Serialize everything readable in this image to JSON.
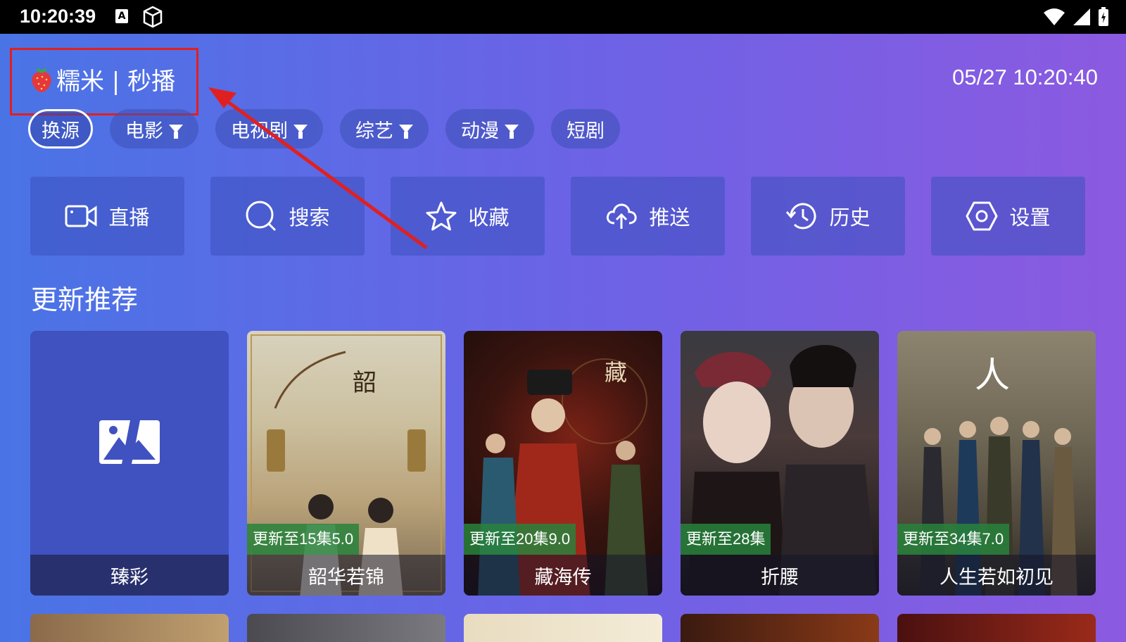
{
  "status": {
    "time": "10:20:39",
    "a_label": "A"
  },
  "header": {
    "brand": "糯米 | 秒播",
    "clock": "05/27 10:20:40"
  },
  "chips": [
    {
      "label": "换源",
      "filter": false,
      "active": true
    },
    {
      "label": "电影",
      "filter": true
    },
    {
      "label": "电视剧",
      "filter": true
    },
    {
      "label": "综艺",
      "filter": true
    },
    {
      "label": "动漫",
      "filter": true
    },
    {
      "label": "短剧",
      "filter": false
    }
  ],
  "actions": [
    {
      "label": "直播",
      "icon": "video-camera-icon"
    },
    {
      "label": "搜索",
      "icon": "search-icon"
    },
    {
      "label": "收藏",
      "icon": "star-icon"
    },
    {
      "label": "推送",
      "icon": "cloud-upload-icon"
    },
    {
      "label": "历史",
      "icon": "history-icon"
    },
    {
      "label": "设置",
      "icon": "gear-icon"
    }
  ],
  "section": {
    "title": "更新推荐"
  },
  "cards": [
    {
      "title": "臻彩",
      "badge": ""
    },
    {
      "title": "韶华若锦",
      "badge": "更新至15集5.0"
    },
    {
      "title": "藏海传",
      "badge": "更新至20集9.0"
    },
    {
      "title": "折腰",
      "badge": "更新至28集"
    },
    {
      "title": "人生若如初见",
      "badge": "更新至34集7.0"
    }
  ],
  "colors": {
    "annotation": "#e02020",
    "badge": "#2e8a43"
  }
}
